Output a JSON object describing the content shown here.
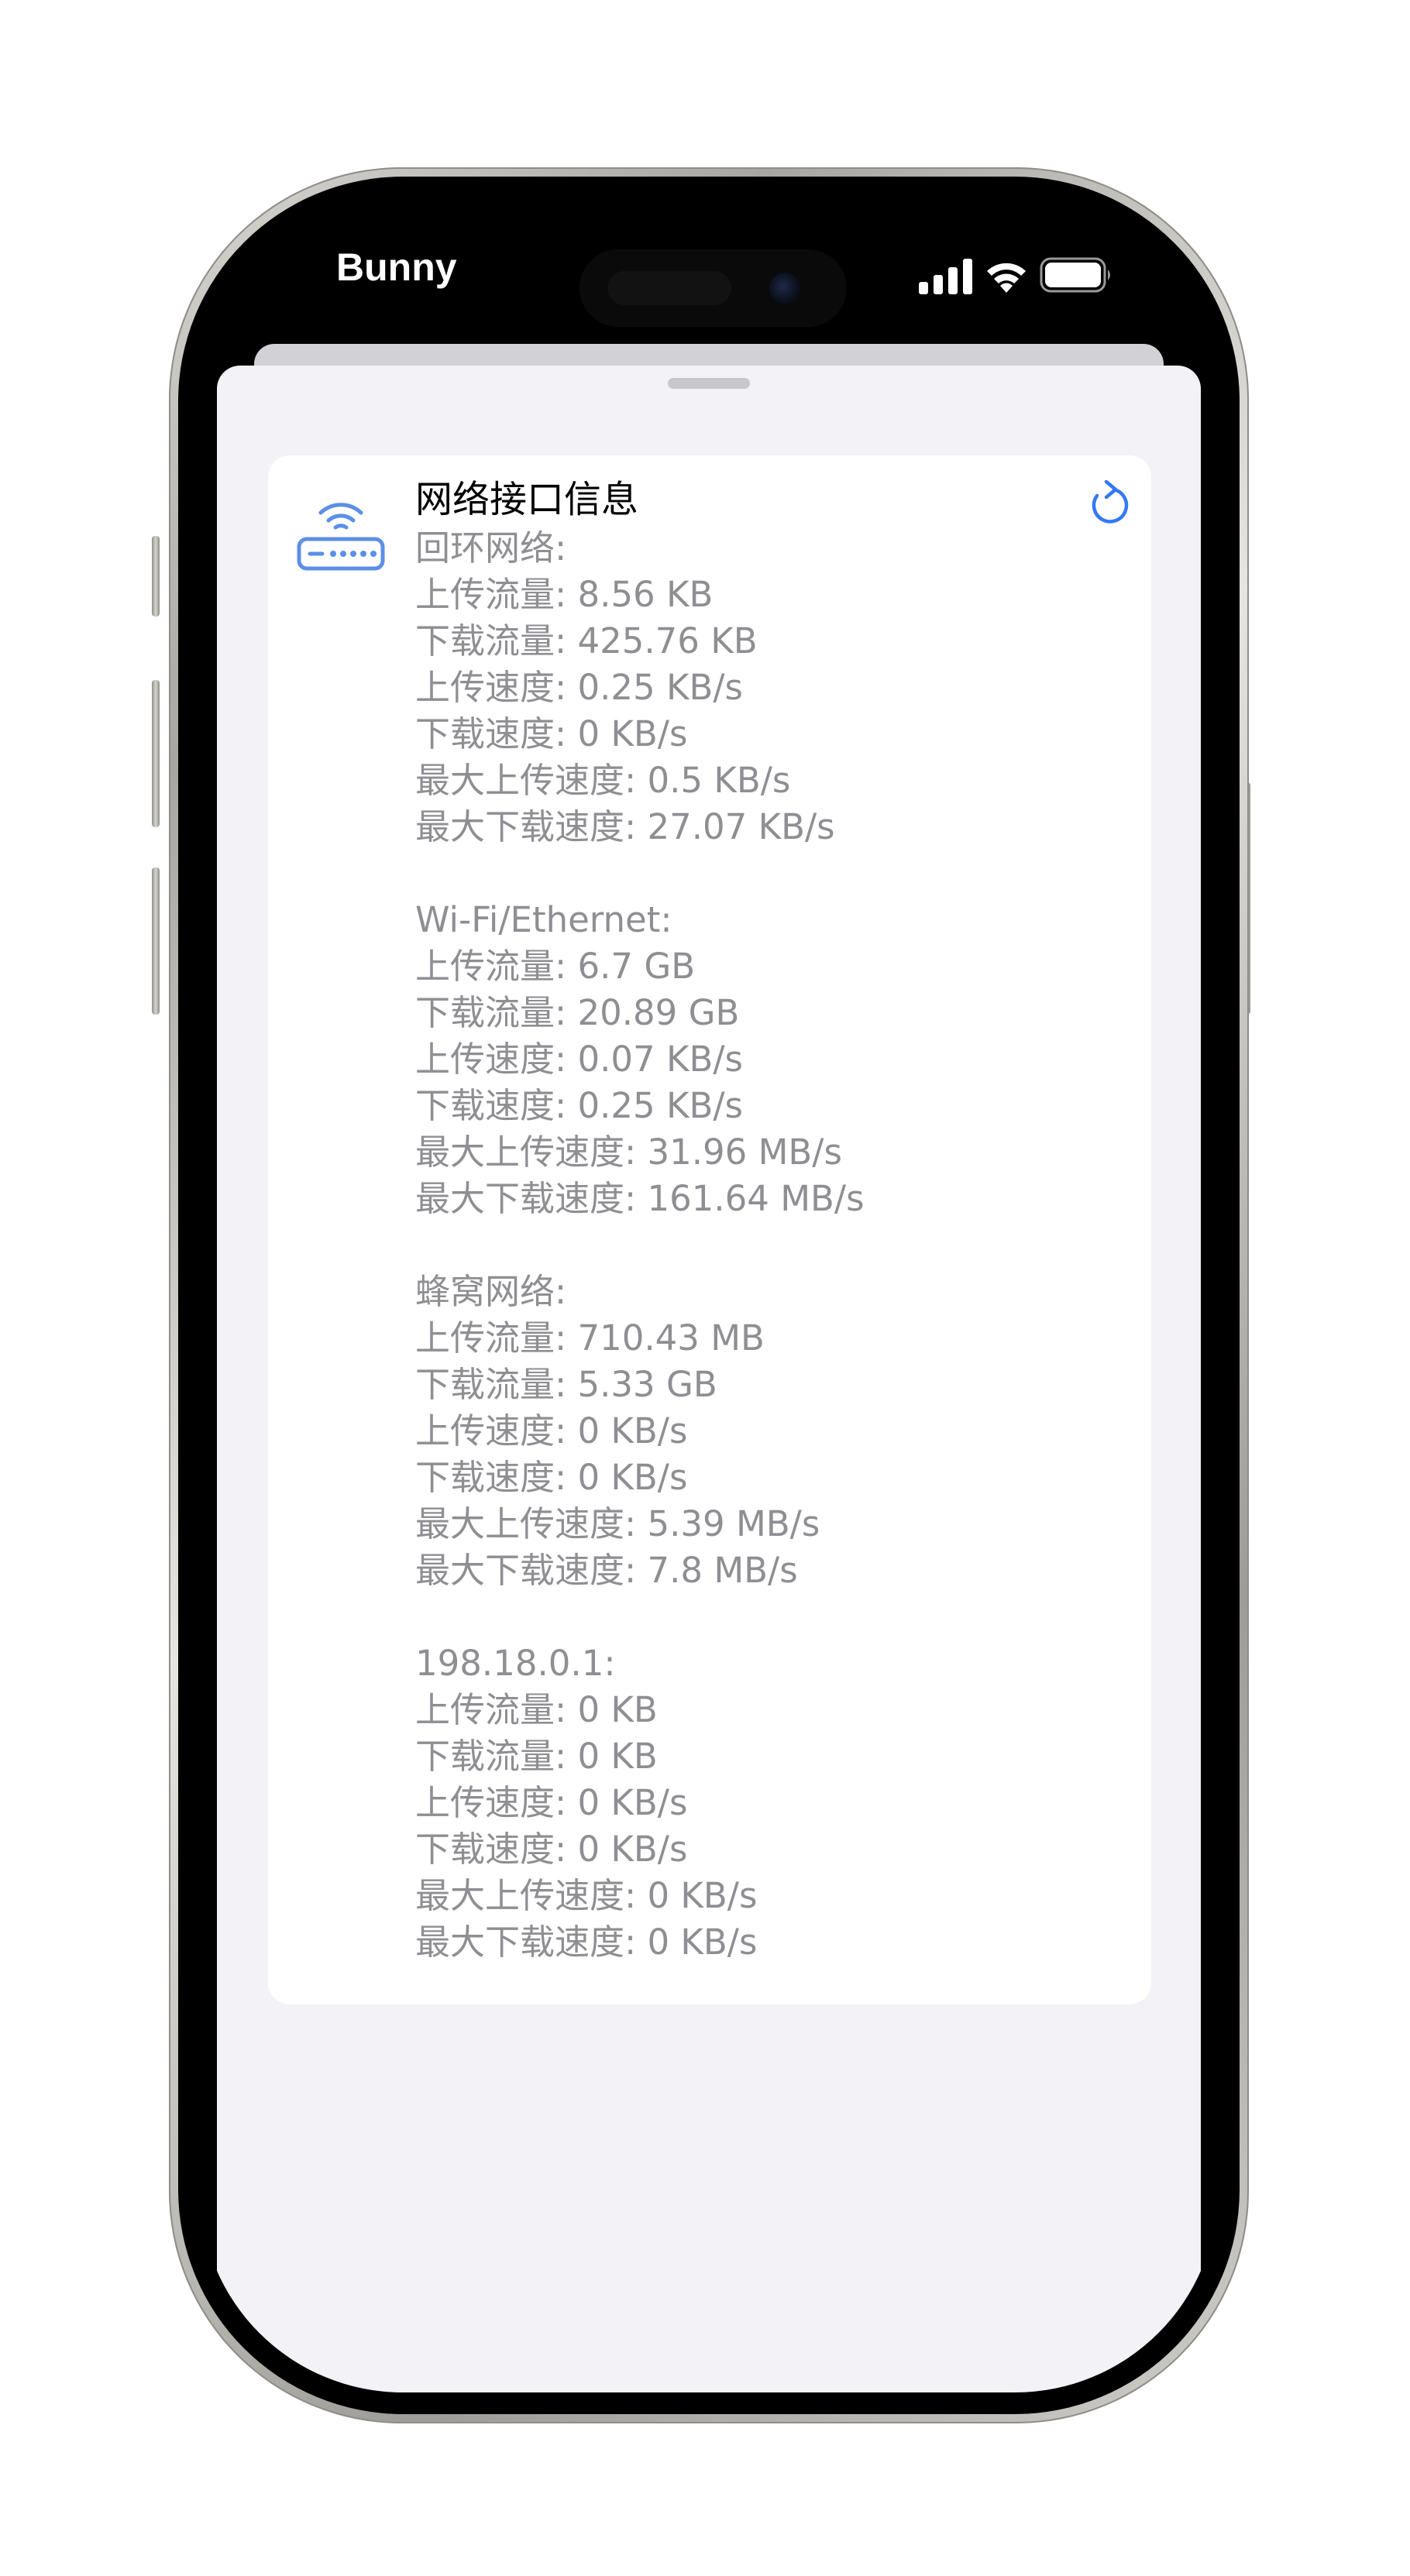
{
  "status_bar": {
    "carrier": "Bunny",
    "icons": [
      "cellular-signal-icon",
      "wifi-icon",
      "battery-icon"
    ]
  },
  "card": {
    "title": "网络接口信息",
    "icon": "router-icon",
    "action_icon": "refresh-icon",
    "sections": [
      {
        "name": "回环网络:",
        "lines": [
          "上传流量: 8.56 KB",
          "下载流量: 425.76 KB",
          "上传速度: 0.25 KB/s",
          "下载速度: 0 KB/s",
          "最大上传速度: 0.5 KB/s",
          "最大下载速度: 27.07 KB/s"
        ]
      },
      {
        "name": "Wi-Fi/Ethernet:",
        "lines": [
          "上传流量: 6.7 GB",
          "下载流量: 20.89 GB",
          "上传速度: 0.07 KB/s",
          "下载速度: 0.25 KB/s",
          "最大上传速度: 31.96 MB/s",
          "最大下载速度: 161.64 MB/s"
        ]
      },
      {
        "name": "蜂窝网络:",
        "lines": [
          "上传流量: 710.43 MB",
          "下载流量: 5.33 GB",
          "上传速度: 0 KB/s",
          "下载速度: 0 KB/s",
          "最大上传速度: 5.39 MB/s",
          "最大下载速度: 7.8 MB/s"
        ]
      },
      {
        "name": "198.18.0.1:",
        "lines": [
          "上传流量: 0 KB",
          "下载流量: 0 KB",
          "上传速度: 0 KB/s",
          "下载速度: 0 KB/s",
          "最大上传速度: 0 KB/s",
          "最大下载速度: 0 KB/s"
        ]
      }
    ]
  },
  "colors": {
    "accent": "#3478f6",
    "router_icon": "#5b8fe8",
    "sheet_background": "#f2f2f7",
    "card_background": "#ffffff",
    "secondary_text": "#8e8e93",
    "primary_text": "#000000"
  }
}
